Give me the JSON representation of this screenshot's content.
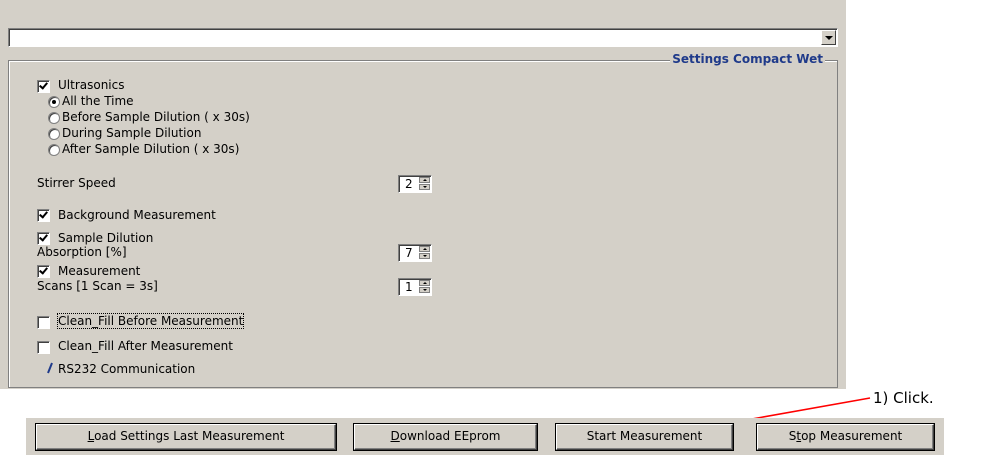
{
  "combo": {
    "value": ""
  },
  "group": {
    "title": "Settings Compact Wet",
    "ultrasonics": {
      "label": "Ultrasonics",
      "checked": true,
      "options": [
        {
          "label": "All the Time",
          "selected": true
        },
        {
          "label": "Before Sample Dilution ( x 30s)",
          "selected": false
        },
        {
          "label": "During Sample Dilution",
          "selected": false
        },
        {
          "label": "After Sample Dilution ( x 30s)",
          "selected": false
        }
      ]
    },
    "stirrer": {
      "label": "Stirrer Speed",
      "value": "2"
    },
    "background": {
      "label": "Background Measurement",
      "checked": true
    },
    "dilution": {
      "label": "Sample Dilution",
      "sub_label": "Absorption [%]",
      "value": "7",
      "checked": true
    },
    "measurement": {
      "label": "Measurement",
      "sub_label": "Scans [1 Scan = 3s]",
      "value": "1",
      "checked": true
    },
    "clean_before": {
      "label": "Clean_Fill Before Measurement",
      "checked": false
    },
    "clean_after": {
      "label": "Clean_Fill After Measurement",
      "checked": false
    },
    "rs232": {
      "label": "RS232 Communication"
    }
  },
  "buttons": {
    "load": {
      "mnemonic": "L",
      "rest": "oad Settings Last Measurement"
    },
    "download": {
      "mnemonic": "D",
      "rest": "ownload EEprom"
    },
    "start": {
      "label": "Start Measurement"
    },
    "stop": {
      "pre": "S",
      "mnemonic": "t",
      "rest": "op Measurement"
    }
  },
  "annotation": {
    "text": "1) Click.",
    "color": "#ff0000"
  },
  "colors": {
    "panel": "#d4d0c8",
    "group_title": "#1f3a8a",
    "rs232_icon": "#1f3a8a"
  }
}
